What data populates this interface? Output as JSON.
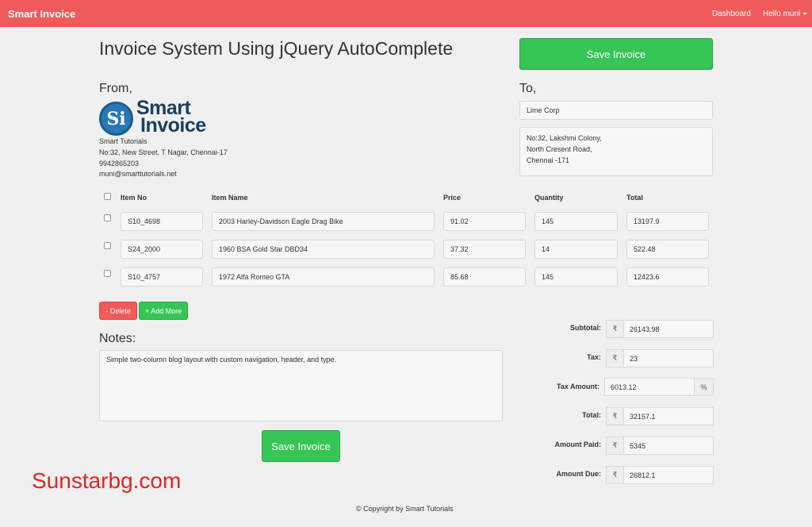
{
  "navbar": {
    "brand": "Smart Invoice",
    "dashboard": "Dashboard",
    "user": "Hello muni",
    "color": "#f05a5a"
  },
  "page_title": "Invoice System Using jQuery AutoComplete",
  "save_invoice_label": "Save Invoice",
  "from": {
    "label": "From,",
    "logo_line1": "Smart",
    "logo_line2": "Invoice",
    "logo_mark": "Si",
    "company": "Smart Tutorials",
    "address": "No:32, New Street, T Nagar, Chennai-17",
    "phone": "9942865203",
    "email": "muni@smarttutorials.net"
  },
  "to": {
    "label": "To,",
    "company": "Lime Corp",
    "address_lines": [
      "No:32, Lakshmi Colony,",
      "North Cresent Road,",
      "Chennai -171"
    ]
  },
  "table": {
    "headers": {
      "item_no": "Item No",
      "item_name": "Item Name",
      "price": "Price",
      "quantity": "Quantity",
      "total": "Total"
    },
    "rows": [
      {
        "item_no": "S10_4698",
        "item_name": "2003 Harley-Davidson Eagle Drag Bike",
        "price": "91.02",
        "quantity": "145",
        "total": "13197.9"
      },
      {
        "item_no": "S24_2000",
        "item_name": "1960 BSA Gold Star DBD34",
        "price": "37.32",
        "quantity": "14",
        "total": "522.48"
      },
      {
        "item_no": "S10_4757",
        "item_name": "1972 Alfa Romeo GTA",
        "price": "85.68",
        "quantity": "145",
        "total": "12423.6"
      }
    ]
  },
  "buttons": {
    "delete": "- Delete",
    "add_more": "+ Add More"
  },
  "notes": {
    "label": "Notes:",
    "text": "Simple two-column blog layout with custom navigation, header, and type."
  },
  "summary": {
    "currency": "₹",
    "percent": "%",
    "subtotal_label": "Subtotal:",
    "subtotal": "26143.98",
    "tax_label": "Tax:",
    "tax": "23",
    "tax_amount_label": "Tax Amount:",
    "tax_amount": "6013.12",
    "total_label": "Total:",
    "total": "32157.1",
    "amount_paid_label": "Amount Paid:",
    "amount_paid": "5345",
    "amount_due_label": "Amount Due:",
    "amount_due": "26812.1"
  },
  "watermark": "Sunstarbg.com",
  "footer": "© Copyright by Smart Tutorials",
  "colors": {
    "green": "#35c655",
    "red": "#f05a5a",
    "logo_blue": "#2878b6"
  }
}
